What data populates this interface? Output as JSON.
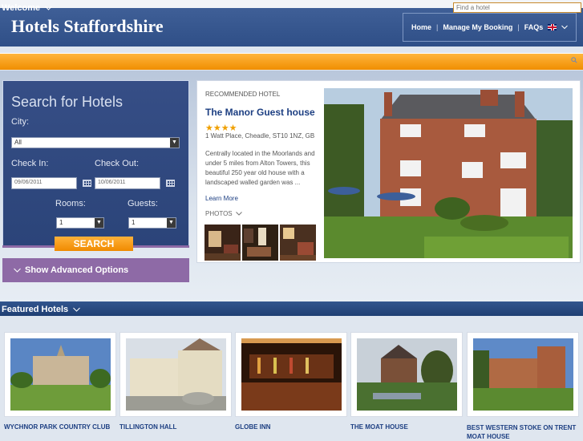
{
  "header": {
    "title": "Hotels Staffordshire"
  },
  "nav": {
    "home": "Home",
    "sep1": "|",
    "manage": "Manage My Booking",
    "sep2": "|",
    "faqs": "FAQs"
  },
  "welcome": {
    "label": "Welcome",
    "search_placeholder": "Find a hotel"
  },
  "search": {
    "title": "Search for Hotels",
    "city_label": "City:",
    "city_value": "All",
    "checkin_label": "Check In:",
    "checkin_value": "09/06/2011",
    "checkout_label": "Check Out:",
    "checkout_value": "10/06/2011",
    "rooms_label": "Rooms:",
    "rooms_value": "1",
    "guests_label": "Guests:",
    "guests_value": "1",
    "button": "SEARCH",
    "advanced": "Show Advanced Options"
  },
  "recommended": {
    "label": "RECOMMENDED HOTEL",
    "name": "The Manor Guest house",
    "stars": "★★★★",
    "address": "1 Watt Place, Cheadle, ST10 1NZ, GB",
    "description": "Centrally located in the Moorlands and under 5 miles from Alton Towers, this beautiful 250 year old house with a landscaped walled garden was ...",
    "learn_more": "Learn More",
    "photos": "PHOTOS"
  },
  "featured": {
    "label": "Featured Hotels",
    "hotels": [
      {
        "name": "WYCHNOR PARK COUNTRY CLUB"
      },
      {
        "name": "TILLINGTON HALL"
      },
      {
        "name": "GLOBE INN"
      },
      {
        "name": "THE MOAT HOUSE"
      },
      {
        "name": "BEST WESTERN STOKE ON TRENT MOAT HOUSE"
      }
    ]
  },
  "colors": {
    "orange": "#f59a0f",
    "navy": "#2f4f87",
    "purple": "#8e6aa6",
    "link": "#1d3f82"
  }
}
